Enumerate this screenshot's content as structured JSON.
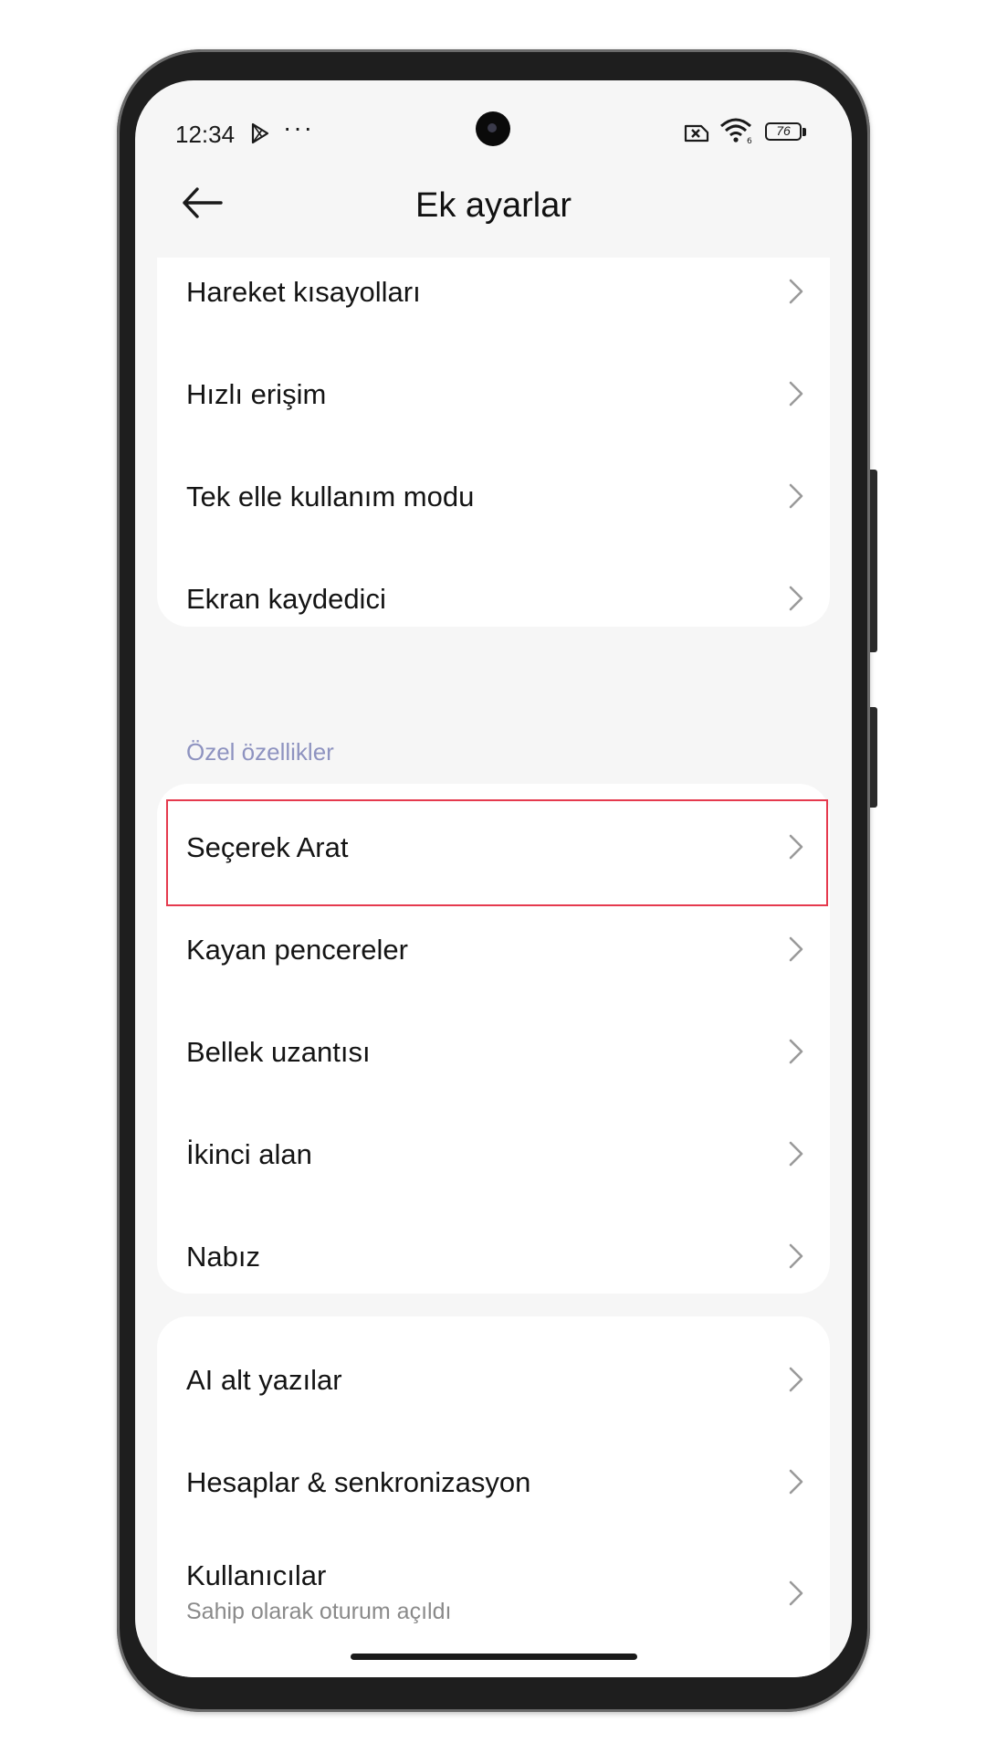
{
  "status_bar": {
    "time": "12:34",
    "more": "···",
    "battery": "76"
  },
  "header": {
    "title": "Ek ayarlar"
  },
  "group1": {
    "items": [
      {
        "label": "Hareket kısayolları"
      },
      {
        "label": "Hızlı erişim"
      },
      {
        "label": "Tek elle kullanım modu"
      },
      {
        "label": "Ekran kaydedici"
      }
    ]
  },
  "section_special": {
    "title": "Özel özellikler",
    "items": [
      {
        "label": "Seçerek Arat"
      },
      {
        "label": "Kayan pencereler"
      },
      {
        "label": "Bellek uzantısı"
      },
      {
        "label": "İkinci alan"
      },
      {
        "label": "Nabız"
      }
    ]
  },
  "group3": {
    "items": [
      {
        "label": "AI alt yazılar"
      },
      {
        "label": "Hesaplar & senkronizasyon"
      },
      {
        "label": "Kullanıcılar",
        "subtitle": "Sahip olarak oturum açıldı"
      }
    ]
  },
  "colors": {
    "highlight": "#e53a4e",
    "section_title": "#8e93c0",
    "background": "#f6f6f6",
    "card": "#ffffff"
  }
}
